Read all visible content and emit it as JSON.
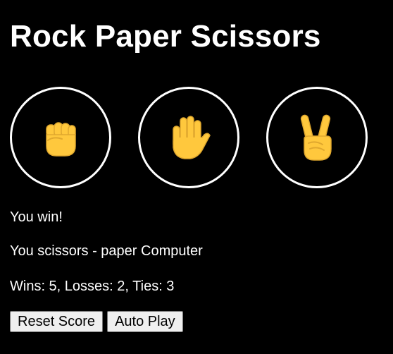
{
  "title": "Rock Paper Scissors",
  "choices": [
    {
      "name": "rock",
      "icon": "raised-fist-icon"
    },
    {
      "name": "paper",
      "icon": "raised-hand-icon"
    },
    {
      "name": "scissors",
      "icon": "victory-hand-icon"
    }
  ],
  "result": "You win!",
  "moves": "You scissors - paper Computer",
  "score": "Wins: 5, Losses: 2, Ties: 3",
  "buttons": {
    "reset_label": "Reset Score",
    "auto_label": "Auto Play"
  },
  "colors": {
    "background": "#000000",
    "text": "#ffffff",
    "circle_border": "#ffffff",
    "emoji_yellow": "#FFC83D",
    "emoji_shade": "#E0A82E",
    "button_bg": "#efefef"
  }
}
